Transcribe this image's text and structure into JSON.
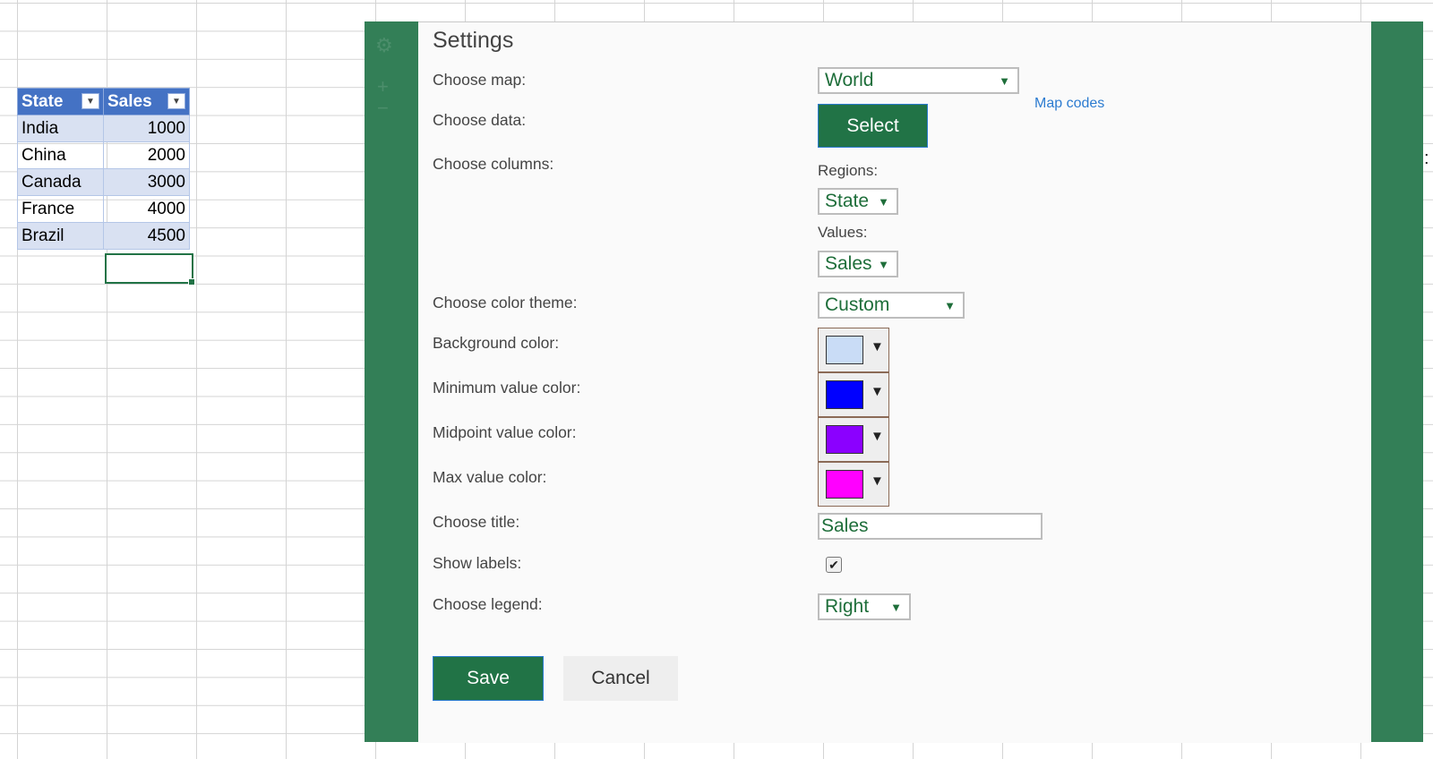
{
  "sheet": {
    "headers": [
      "State",
      "Sales"
    ],
    "rows": [
      {
        "state": "India",
        "sales": "1000"
      },
      {
        "state": "China",
        "sales": "2000"
      },
      {
        "state": "Canada",
        "sales": "3000"
      },
      {
        "state": "France",
        "sales": "4000"
      },
      {
        "state": "Brazil",
        "sales": "4500"
      }
    ]
  },
  "background_ticks": [
    "1000",
    "2000",
    "3000",
    "4000",
    "5000"
  ],
  "settings": {
    "title": "Settings",
    "choose_map_label": "Choose map:",
    "map_value": "World",
    "map_codes_link": "Map codes",
    "choose_data_label": "Choose data:",
    "select_button": "Select",
    "choose_columns_label": "Choose columns:",
    "regions_label": "Regions:",
    "regions_value": "State",
    "values_label": "Values:",
    "values_value": "Sales",
    "color_theme_label": "Choose color theme:",
    "color_theme_value": "Custom",
    "background_color_label": "Background color:",
    "background_color": "#c9dcf6",
    "min_color_label": "Minimum value color:",
    "min_color": "#0000ff",
    "mid_color_label": "Midpoint value color:",
    "mid_color": "#8b00ff",
    "max_color_label": "Max value color:",
    "max_color": "#ff00ff",
    "choose_title_label": "Choose title:",
    "title_value": "Sales",
    "show_labels_label": "Show labels:",
    "show_labels_checked": true,
    "choose_legend_label": "Choose legend:",
    "legend_value": "Right",
    "save_button": "Save",
    "cancel_button": "Cancel"
  },
  "colors": {
    "accent_green": "#217346",
    "addin_frame": "#337f57",
    "table_header": "#4472c4",
    "table_band": "#d9e1f2"
  },
  "icons": {
    "gear": "gear-icon",
    "dropdown": "chevron-down-icon",
    "filter": "filter-dropdown-icon",
    "checkbox": "checkmark-icon"
  }
}
